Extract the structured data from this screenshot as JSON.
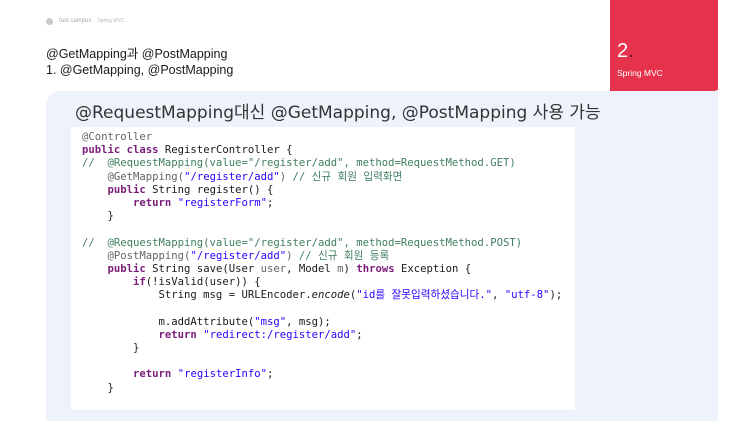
{
  "header": {
    "logo_text": "fast campus",
    "breadcrumb": "Spring MVC"
  },
  "section": {
    "title": "@GetMapping과 @PostMapping",
    "subtitle": "1. @GetMapping, @PostMapping"
  },
  "chapter": {
    "number": "2",
    "dot": ".",
    "label": "Spring MVC"
  },
  "panel": {
    "title": "@RequestMapping대신 @GetMapping, @PostMapping 사용 가능"
  },
  "code": {
    "lines": [
      [
        {
          "t": "@Controller",
          "c": "ann"
        }
      ],
      [
        {
          "t": "public class ",
          "c": "kw"
        },
        {
          "t": "RegisterController {",
          "c": ""
        }
      ],
      [
        {
          "t": "//  @RequestMapping(value=\"/register/add\", method=RequestMethod.GET)",
          "c": "cm"
        }
      ],
      [
        {
          "t": "    ",
          "c": ""
        },
        {
          "t": "@GetMapping(",
          "c": "ann"
        },
        {
          "t": "\"/register/add\"",
          "c": "str"
        },
        {
          "t": ") ",
          "c": "ann"
        },
        {
          "t": "// 신규 회원 입력화면",
          "c": "cm"
        }
      ],
      [
        {
          "t": "    ",
          "c": ""
        },
        {
          "t": "public ",
          "c": "kw"
        },
        {
          "t": "String register() {",
          "c": ""
        }
      ],
      [
        {
          "t": "        ",
          "c": ""
        },
        {
          "t": "return ",
          "c": "kw"
        },
        {
          "t": "\"registerForm\"",
          "c": "str"
        },
        {
          "t": ";",
          "c": ""
        }
      ],
      [
        {
          "t": "    }",
          "c": ""
        }
      ],
      [
        {
          "t": "",
          "c": ""
        }
      ],
      [
        {
          "t": "//  @RequestMapping(value=\"/register/add\", method=RequestMethod.POST)",
          "c": "cm"
        }
      ],
      [
        {
          "t": "    ",
          "c": ""
        },
        {
          "t": "@PostMapping(",
          "c": "ann"
        },
        {
          "t": "\"/register/add\"",
          "c": "str"
        },
        {
          "t": ") ",
          "c": "ann"
        },
        {
          "t": "// 신규 회원 등록",
          "c": "cm"
        }
      ],
      [
        {
          "t": "    ",
          "c": ""
        },
        {
          "t": "public ",
          "c": "kw"
        },
        {
          "t": "String save(User ",
          "c": ""
        },
        {
          "t": "user",
          "c": "ann"
        },
        {
          "t": ", Model ",
          "c": ""
        },
        {
          "t": "m",
          "c": "ann"
        },
        {
          "t": ") ",
          "c": ""
        },
        {
          "t": "throws ",
          "c": "kw"
        },
        {
          "t": "Exception {",
          "c": ""
        }
      ],
      [
        {
          "t": "        ",
          "c": ""
        },
        {
          "t": "if",
          "c": "kw"
        },
        {
          "t": "(!isValid(user)) {",
          "c": ""
        }
      ],
      [
        {
          "t": "            String msg = URLEncoder.",
          "c": ""
        },
        {
          "t": "encode",
          "c": "it"
        },
        {
          "t": "(",
          "c": ""
        },
        {
          "t": "\"id를 잘못입력하셨습니다.\"",
          "c": "str"
        },
        {
          "t": ", ",
          "c": ""
        },
        {
          "t": "\"utf-8\"",
          "c": "str"
        },
        {
          "t": ");",
          "c": ""
        }
      ],
      [
        {
          "t": "",
          "c": ""
        }
      ],
      [
        {
          "t": "            m.addAttribute(",
          "c": ""
        },
        {
          "t": "\"msg\"",
          "c": "str"
        },
        {
          "t": ", msg);",
          "c": ""
        }
      ],
      [
        {
          "t": "            ",
          "c": ""
        },
        {
          "t": "return ",
          "c": "kw"
        },
        {
          "t": "\"redirect:/register/add\"",
          "c": "str"
        },
        {
          "t": ";",
          "c": ""
        }
      ],
      [
        {
          "t": "        }",
          "c": ""
        }
      ],
      [
        {
          "t": "",
          "c": ""
        }
      ],
      [
        {
          "t": "        ",
          "c": ""
        },
        {
          "t": "return ",
          "c": "kw"
        },
        {
          "t": "\"registerInfo\"",
          "c": "str"
        },
        {
          "t": ";",
          "c": ""
        }
      ],
      [
        {
          "t": "    }",
          "c": ""
        }
      ]
    ]
  },
  "colors": {
    "accent": "#e5324d",
    "panel_bg": "#eef2fb",
    "keyword": "#7a1d7a",
    "string": "#2a00ff",
    "comment": "#3f7f5f"
  }
}
